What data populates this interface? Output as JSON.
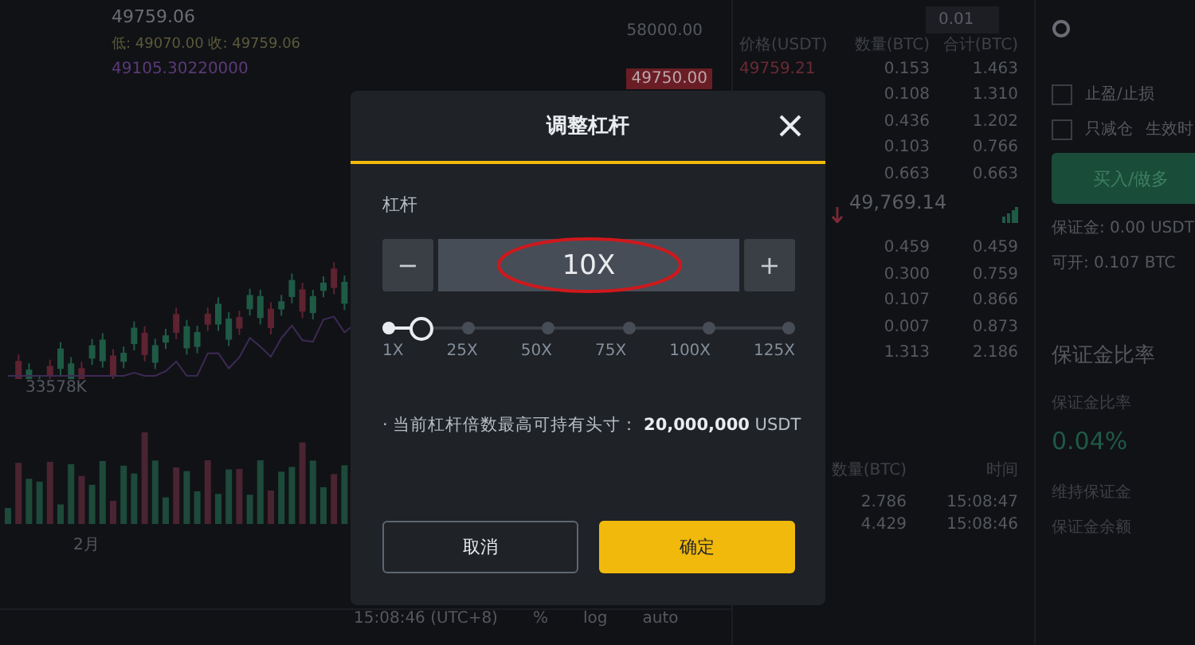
{
  "chart": {
    "last_price": "49759.06",
    "ohlc_line": "低: 49070.00  收: 49759.06",
    "ma_value": "49105.30220000",
    "axis_price": "58000.00",
    "price_tag": "49750.00",
    "volume": "33578K",
    "month_label": "2月",
    "toolbar": [
      "15:08:46 (UTC+8)",
      "%",
      "log",
      "auto"
    ]
  },
  "order_book": {
    "step": "0.01",
    "columns": [
      "价格(USDT)",
      "数量(BTC)",
      "合计(BTC)"
    ],
    "asks": [
      {
        "price": "49759.21",
        "qty": "0.153",
        "total": "1.463"
      },
      {
        "qty": "0.108",
        "total": "1.310"
      },
      {
        "qty": "0.436",
        "total": "1.202"
      },
      {
        "qty": "0.103",
        "total": "0.766"
      },
      {
        "qty": "0.663",
        "total": "0.663"
      }
    ],
    "mid_price": "49,769.14",
    "bids": [
      {
        "qty": "0.459",
        "total": "0.459"
      },
      {
        "qty": "0.300",
        "total": "0.759"
      },
      {
        "qty": "0.107",
        "total": "0.866"
      },
      {
        "qty": "0.007",
        "total": "0.873"
      },
      {
        "qty": "1.313",
        "total": "2.186"
      }
    ],
    "trades_columns": [
      "数量(BTC)",
      "时间"
    ],
    "trades": [
      {
        "qty": "2.786",
        "time": "15:08:47"
      },
      {
        "qty": "4.429",
        "time": "15:08:46"
      }
    ]
  },
  "order_panel": {
    "options": [
      {
        "label": "止盈/止损",
        "checked": false
      },
      {
        "label": "只减仓",
        "checked": false
      }
    ],
    "time_in_force": "生效时",
    "buy_button": "买入/做多",
    "margin": "保证金: 0.00 USDT",
    "available": "可开: 0.107 BTC",
    "ratio_title": "保证金比率",
    "ratio_label": "保证金比率",
    "ratio_value": "0.04%",
    "maintenance": "维持保证金",
    "balance": "保证金余额"
  },
  "dialog": {
    "title": "调整杠杆",
    "field_label": "杠杆",
    "minus": "−",
    "value": "10X",
    "plus": "+",
    "value_highlighted": true,
    "slider": {
      "level": 0.07,
      "marks": [
        "1X",
        "25X",
        "50X",
        "75X",
        "100X",
        "125X"
      ]
    },
    "info": "· 当前杠杆倍数最高可持有头寸： **20,000,000** USDT",
    "cancel": "取消",
    "confirm": "确定"
  }
}
